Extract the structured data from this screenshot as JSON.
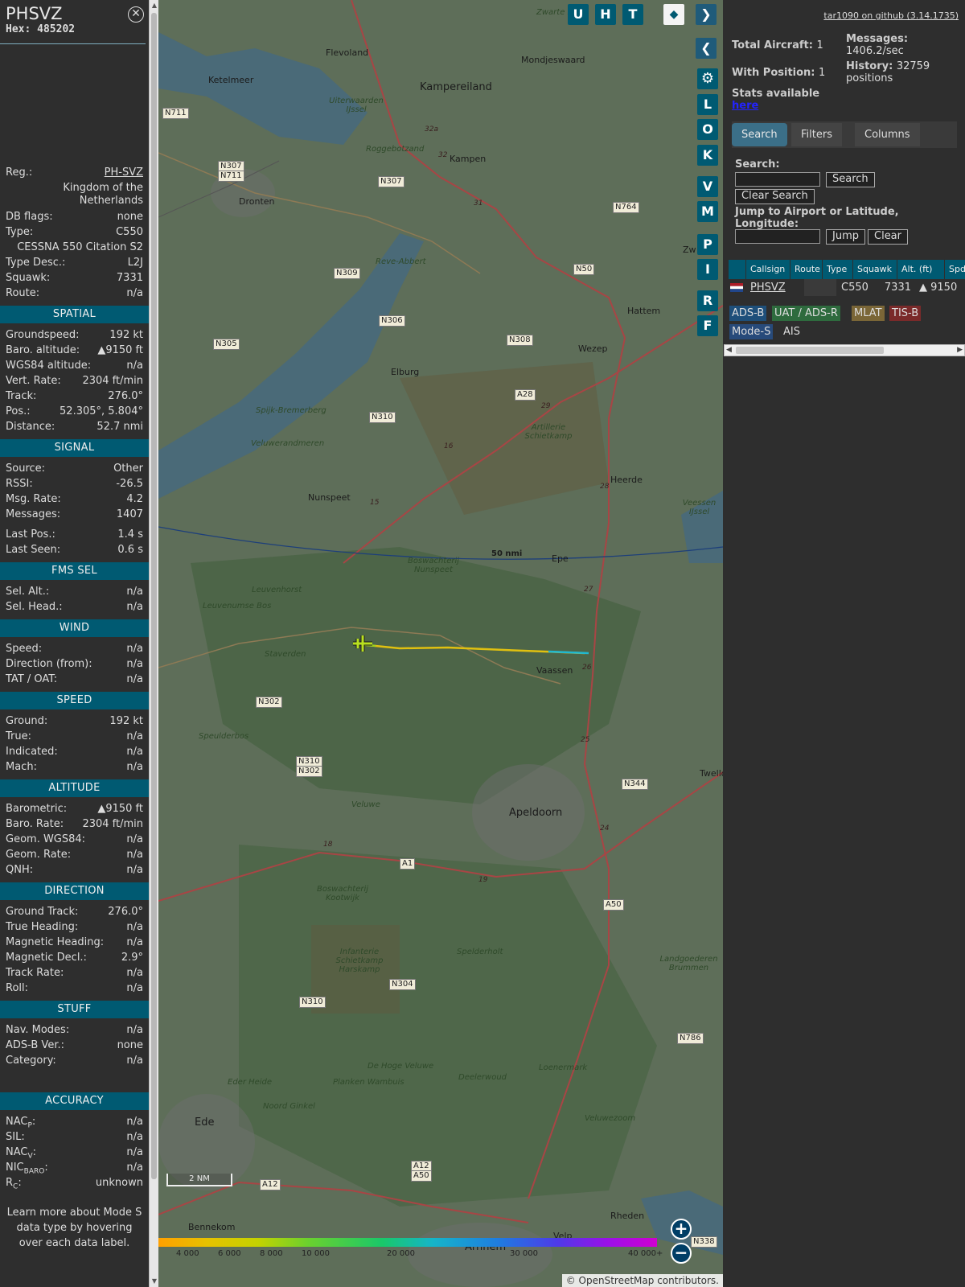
{
  "info": {
    "callsign": "PHSVZ",
    "hex_label": "Hex:",
    "hex": "485202",
    "close_icon": "close-icon",
    "rows_top": [
      {
        "label": "Reg.:",
        "value": "PH-SVZ",
        "link": true
      },
      {
        "label": "",
        "value": "Kingdom of the Netherlands",
        "multi": true
      },
      {
        "label": "DB flags:",
        "value": "none"
      },
      {
        "label": "Type:",
        "value": "C550"
      },
      {
        "label": "",
        "value": "CESSNA 550 Citation S2",
        "center": true
      },
      {
        "label": "Type Desc.:",
        "value": "L2J"
      },
      {
        "label": "Squawk:",
        "value": "7331"
      },
      {
        "label": "Route:",
        "value": "n/a"
      }
    ],
    "sections": [
      {
        "title": "SPATIAL",
        "rows": [
          {
            "label": "Groundspeed:",
            "value": "192 kt"
          },
          {
            "label": "Baro. altitude:",
            "value": "▲9150 ft"
          },
          {
            "label": "WGS84 altitude:",
            "value": "n/a"
          },
          {
            "label": "Vert. Rate:",
            "value": "2304 ft/min"
          },
          {
            "label": "Track:",
            "value": "276.0°"
          },
          {
            "label": "Pos.:",
            "value": "52.305°, 5.804°"
          },
          {
            "label": "Distance:",
            "value": "52.7 nmi"
          }
        ]
      },
      {
        "title": "SIGNAL",
        "rows": [
          {
            "label": "Source:",
            "value": "Other"
          },
          {
            "label": "RSSI:",
            "value": "-26.5"
          },
          {
            "label": "Msg. Rate:",
            "value": "4.2"
          },
          {
            "label": "Messages:",
            "value": "1407"
          },
          {
            "label": "Last Pos.:",
            "value": "1.4 s",
            "gap_before": true
          },
          {
            "label": "Last Seen:",
            "value": "0.6 s"
          }
        ]
      },
      {
        "title": "FMS SEL",
        "rows": [
          {
            "label": "Sel. Alt.:",
            "value": "n/a"
          },
          {
            "label": "Sel. Head.:",
            "value": "n/a"
          }
        ]
      },
      {
        "title": "WIND",
        "rows": [
          {
            "label": "Speed:",
            "value": "n/a"
          },
          {
            "label": "Direction (from):",
            "value": "n/a"
          },
          {
            "label": "TAT / OAT:",
            "value": "n/a"
          }
        ]
      },
      {
        "title": "SPEED",
        "rows": [
          {
            "label": "Ground:",
            "value": "192 kt"
          },
          {
            "label": "True:",
            "value": "n/a"
          },
          {
            "label": "Indicated:",
            "value": "n/a"
          },
          {
            "label": "Mach:",
            "value": "n/a"
          }
        ]
      },
      {
        "title": "ALTITUDE",
        "rows": [
          {
            "label": "Barometric:",
            "value": "▲9150 ft"
          },
          {
            "label": "Baro. Rate:",
            "value": "2304 ft/min"
          },
          {
            "label": "Geom. WGS84:",
            "value": "n/a"
          },
          {
            "label": "Geom. Rate:",
            "value": "n/a"
          },
          {
            "label": "QNH:",
            "value": "n/a"
          }
        ]
      },
      {
        "title": "DIRECTION",
        "rows": [
          {
            "label": "Ground Track:",
            "value": "276.0°"
          },
          {
            "label": "True Heading:",
            "value": "n/a"
          },
          {
            "label": "Magnetic Heading:",
            "value": "n/a"
          },
          {
            "label": "Magnetic Decl.:",
            "value": "2.9°"
          },
          {
            "label": "Track Rate:",
            "value": "n/a"
          },
          {
            "label": "Roll:",
            "value": "n/a"
          }
        ]
      },
      {
        "title": "STUFF",
        "rows": [
          {
            "label": "Nav. Modes:",
            "value": "n/a"
          },
          {
            "label": "ADS-B Ver.:",
            "value": "none"
          },
          {
            "label": "Category:",
            "value": "n/a"
          }
        ]
      },
      {
        "title": "ACCURACY",
        "gap_before": true,
        "rows": [
          {
            "label": "NAC",
            "sub": "P",
            "value": "n/a"
          },
          {
            "label": "SIL:",
            "value": "n/a"
          },
          {
            "label": "NAC",
            "sub": "V",
            "value": "n/a"
          },
          {
            "label": "NIC",
            "sub": "BARO",
            "value": "n/a"
          },
          {
            "label": "R",
            "sub": "C",
            "value": "unknown"
          }
        ]
      }
    ],
    "learn_more": "Learn more about Mode S data type by hovering over each data label."
  },
  "map": {
    "buttons_top": [
      "U",
      "H",
      "T"
    ],
    "layers_icon": "layers-icon",
    "expand_icon": "chevron-right-icon",
    "swap_icon": "left-right-arrows-icon",
    "collapse_icon": "chevron-left-icon",
    "settings_icon": "gear-icon",
    "buttons_side": [
      "L",
      "O",
      "K",
      "V",
      "M",
      "P",
      "I",
      "R",
      "F"
    ],
    "zoom_in": "+",
    "zoom_out": "−",
    "scale_label": "2 NM",
    "range_ring_label": "50 nmi",
    "altitude_scale": [
      "4 000",
      "6 000",
      "8 000",
      "10 000",
      "20 000",
      "30 000",
      "40 000+"
    ],
    "attribution_prefix": "©",
    "attribution_link": "OpenStreetMap",
    "attribution_suffix": "contributors.",
    "places": [
      {
        "name": "Kampereiland",
        "big": true
      },
      {
        "name": "Kampen"
      },
      {
        "name": "Dronten"
      },
      {
        "name": "Elburg"
      },
      {
        "name": "Nunspeet"
      },
      {
        "name": "Heerde"
      },
      {
        "name": "Hattem"
      },
      {
        "name": "Wezep"
      },
      {
        "name": "Epe"
      },
      {
        "name": "Vaassen"
      },
      {
        "name": "Apeldoorn",
        "big": true
      },
      {
        "name": "Ede",
        "big": true
      },
      {
        "name": "Bennekom"
      },
      {
        "name": "Arnhem",
        "big": true
      },
      {
        "name": "Rheden"
      },
      {
        "name": "Velp"
      },
      {
        "name": "Mondjeswaard"
      },
      {
        "name": "Ketelmeer"
      },
      {
        "name": "Flevoland"
      },
      {
        "name": "Zw"
      },
      {
        "name": "Twello"
      }
    ],
    "areas": [
      "Uiterwaarden IJssel",
      "Roggebotzand",
      "Reve-Abbert",
      "Spijk-Bremerberg",
      "Veluwerandmeren",
      "Artillerie Schietkamp",
      "Boswachterij Nunspeet",
      "Leuvenhorst",
      "Leuvenumse Bos",
      "Staverden",
      "Speulderbos",
      "Veluwe",
      "Boswachterij Kootwijk",
      "Infanterie Schietkamp Harskamp",
      "Spelderholt",
      "Landgoederen Brummen",
      "Loenermark",
      "De Hoge Veluwe",
      "Deelerwoud",
      "Eder Heide",
      "Noord Ginkel",
      "Planken Wambuis",
      "Veluwezoom",
      "Zwarte Meer",
      "Veessen IJssel"
    ],
    "shields": [
      "N711",
      "N307",
      "N711",
      "N307",
      "N309",
      "N306",
      "N305",
      "N310",
      "N308",
      "N764",
      "N50",
      "A28",
      "N302",
      "N310",
      "N302",
      "N344",
      "A1",
      "A50",
      "N304",
      "N310",
      "N786",
      "A12",
      "A50",
      "A12",
      "N338"
    ]
  },
  "side": {
    "github": "tar1090 on github (3.14.1735)",
    "total_label": "Total Aircraft:",
    "total": "1",
    "messages_label": "Messages:",
    "messages": "1406.2/sec",
    "withpos_label": "With Position:",
    "withpos": "1",
    "history_label": "History:",
    "history": "32759 positions",
    "stats_label": "Stats available",
    "stats_link": "here",
    "tabs": [
      "Search",
      "Filters",
      "Columns"
    ],
    "search_label": "Search:",
    "search_btn": "Search",
    "clear_search_btn": "Clear Search",
    "jump_label": "Jump to Airport or Latitude, Longitude:",
    "jump_btn": "Jump",
    "clear_btn": "Clear",
    "columns": [
      "",
      "Callsign",
      "Route",
      "Type",
      "Squawk",
      "Alt. (ft)",
      "Spd"
    ],
    "row": {
      "flag": "netherlands-flag-icon",
      "callsign": "PHSVZ",
      "route": "",
      "type": "C550",
      "squawk": "7331",
      "alt": "▲ 9150"
    },
    "sources": [
      {
        "label": "ADS-B",
        "color": "#1e4f7a"
      },
      {
        "label": "UAT / ADS-R",
        "color": "#2e6b3e"
      },
      {
        "label": "MLAT",
        "color": "#7a6637"
      },
      {
        "label": "TIS-B",
        "color": "#7a2a2a"
      },
      {
        "label": "Mode-S",
        "color": "#274a7a"
      },
      {
        "label": "AIS",
        "color": "#2e2e2e"
      }
    ]
  }
}
